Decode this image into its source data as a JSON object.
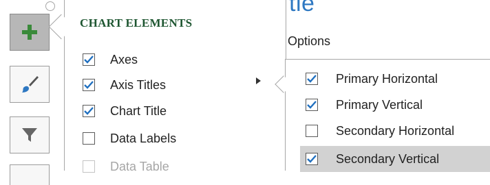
{
  "background": {
    "title_fragment": "tle",
    "options_fragment": "Options"
  },
  "sidebar": {
    "buttons": [
      {
        "name": "chart-elements-button",
        "icon": "plus-icon"
      },
      {
        "name": "chart-styles-button",
        "icon": "paintbrush-icon"
      },
      {
        "name": "chart-filters-button",
        "icon": "funnel-icon"
      }
    ]
  },
  "chart_elements": {
    "title": "CHART ELEMENTS",
    "items": [
      {
        "label": "Axes",
        "checked": true,
        "enabled": true
      },
      {
        "label": "Axis Titles",
        "checked": true,
        "enabled": true
      },
      {
        "label": "Chart Title",
        "checked": true,
        "enabled": true
      },
      {
        "label": "Data Labels",
        "checked": false,
        "enabled": true
      },
      {
        "label": "Data Table",
        "checked": false,
        "enabled": false
      }
    ]
  },
  "axis_titles_submenu": {
    "items": [
      {
        "label": "Primary Horizontal",
        "checked": true
      },
      {
        "label": "Primary Vertical",
        "checked": true
      },
      {
        "label": "Secondary Horizontal",
        "checked": false
      },
      {
        "label": "Secondary Vertical",
        "checked": true,
        "highlighted": true
      }
    ]
  },
  "colors": {
    "accent_green": "#1e5631",
    "check_blue": "#1f6fbf",
    "highlight": "#d2d2d2"
  }
}
